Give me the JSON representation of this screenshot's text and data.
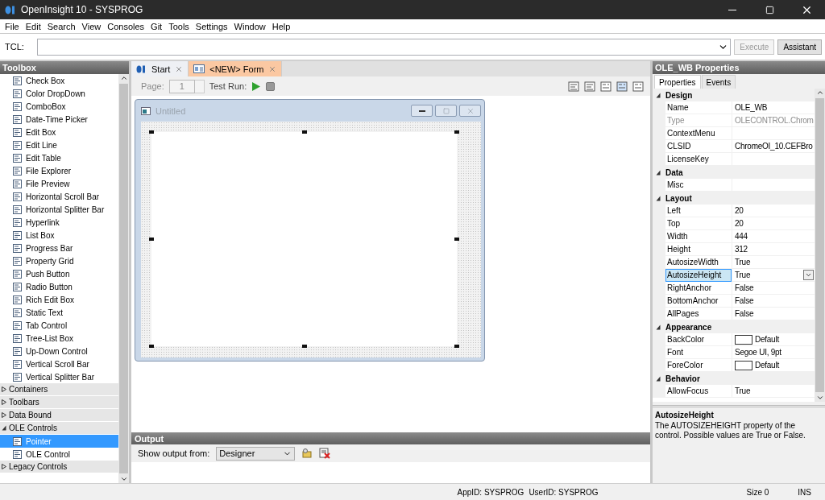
{
  "window": {
    "title": "OpenInsight 10 - SYSPROG"
  },
  "menu": [
    "File",
    "Edit",
    "Search",
    "View",
    "Consoles",
    "Git",
    "Tools",
    "Settings",
    "Window",
    "Help"
  ],
  "tcl": {
    "label": "TCL:"
  },
  "tcl_buttons": [
    {
      "label": "Execute",
      "disabled": true
    },
    {
      "label": "Assistant",
      "disabled": false
    }
  ],
  "toolbox": {
    "title": "Toolbox",
    "items": [
      {
        "label": "Check Box",
        "selected": false
      },
      {
        "label": "Color DropDown",
        "selected": false
      },
      {
        "label": "ComboBox",
        "selected": false
      },
      {
        "label": "Date-Time Picker",
        "selected": false
      },
      {
        "label": "Edit Box",
        "selected": false
      },
      {
        "label": "Edit Line",
        "selected": false
      },
      {
        "label": "Edit Table",
        "selected": false
      },
      {
        "label": "File Explorer",
        "selected": false
      },
      {
        "label": "File Preview",
        "selected": false
      },
      {
        "label": "Horizontal Scroll Bar",
        "selected": false
      },
      {
        "label": "Horizontal Splitter Bar",
        "selected": false
      },
      {
        "label": "Hyperlink",
        "selected": false
      },
      {
        "label": "List Box",
        "selected": false
      },
      {
        "label": "Progress Bar",
        "selected": false
      },
      {
        "label": "Property Grid",
        "selected": false
      },
      {
        "label": "Push Button",
        "selected": false
      },
      {
        "label": "Radio Button",
        "selected": false
      },
      {
        "label": "Rich Edit Box",
        "selected": false
      },
      {
        "label": "Static Text",
        "selected": false
      },
      {
        "label": "Tab Control",
        "selected": false
      },
      {
        "label": "Tree-List Box",
        "selected": false
      },
      {
        "label": "Up-Down Control",
        "selected": false
      },
      {
        "label": "Vertical Scroll Bar",
        "selected": false
      },
      {
        "label": "Vertical Splitter Bar",
        "selected": false
      }
    ],
    "groups": [
      {
        "label": "Containers",
        "expanded": false
      },
      {
        "label": "Toolbars",
        "expanded": false
      },
      {
        "label": "Data Bound",
        "expanded": false
      },
      {
        "label": "OLE Controls",
        "expanded": true,
        "children": [
          {
            "label": "Pointer",
            "selected": true
          },
          {
            "label": "OLE Control",
            "selected": false
          }
        ]
      },
      {
        "label": "Legacy Controls",
        "expanded": false
      }
    ]
  },
  "documents": {
    "tabs": [
      {
        "label": "Start",
        "kind": "start",
        "selected": false
      },
      {
        "label": "<NEW> Form",
        "kind": "designer",
        "selected": true
      }
    ],
    "toolbar": {
      "page_label": "Page:",
      "page_value": "1",
      "page_disabled": true,
      "test_run_label": "Test Run:"
    },
    "form": {
      "title": "Untitled"
    }
  },
  "output": {
    "title": "Output",
    "filter_label": "Show output from:",
    "filter_value": "Designer"
  },
  "properties": {
    "title": "OLE_WB Properties",
    "tabs": [
      {
        "label": "Properties",
        "selected": true
      },
      {
        "label": "Events",
        "selected": false
      }
    ],
    "categories": [
      {
        "label": "Design",
        "expanded": true,
        "rows": [
          {
            "name": "Name",
            "value": "OLE_WB",
            "kind": "text",
            "selected": false,
            "disabled": false
          },
          {
            "name": "Type",
            "value": "OLECONTROL.Chrom",
            "kind": "text",
            "selected": false,
            "disabled": true
          },
          {
            "name": "ContextMenu",
            "kind": "text",
            "selected": false,
            "disabled": false
          },
          {
            "name": "CLSID",
            "value": "ChromeOI_10.CEFBro",
            "kind": "text",
            "selected": false,
            "disabled": false
          },
          {
            "name": "LicenseKey",
            "kind": "text",
            "selected": false,
            "disabled": false
          }
        ]
      },
      {
        "label": "Data",
        "expanded": true,
        "rows": [
          {
            "name": "Misc",
            "kind": "text",
            "selected": false,
            "disabled": false
          }
        ]
      },
      {
        "label": "Layout",
        "expanded": true,
        "rows": [
          {
            "name": "Left",
            "value": "20",
            "kind": "text",
            "selected": false,
            "disabled": false
          },
          {
            "name": "Top",
            "value": "20",
            "kind": "text",
            "selected": false,
            "disabled": false
          },
          {
            "name": "Width",
            "value": "444",
            "kind": "text",
            "selected": false,
            "disabled": false
          },
          {
            "name": "Height",
            "value": "312",
            "kind": "text",
            "selected": false,
            "disabled": false
          },
          {
            "name": "AutosizeWidth",
            "value": "True",
            "kind": "text",
            "selected": false,
            "disabled": false
          },
          {
            "name": "AutosizeHeight",
            "value": "True",
            "kind": "text",
            "selected": true,
            "disabled": false
          },
          {
            "name": "RightAnchor",
            "value": "False",
            "kind": "text",
            "selected": false,
            "disabled": false
          },
          {
            "name": "BottomAnchor",
            "value": "False",
            "kind": "text",
            "selected": false,
            "disabled": false
          },
          {
            "name": "AllPages",
            "value": "False",
            "kind": "text",
            "selected": false,
            "disabled": false
          }
        ]
      },
      {
        "label": "Appearance",
        "expanded": true,
        "rows": [
          {
            "name": "BackColor",
            "value": "Default",
            "kind": "color",
            "selected": false,
            "disabled": false
          },
          {
            "name": "Font",
            "value": "Segoe UI, 9pt",
            "kind": "text",
            "selected": false,
            "disabled": false
          },
          {
            "name": "ForeColor",
            "value": "Default",
            "kind": "color",
            "selected": false,
            "disabled": false
          }
        ]
      },
      {
        "label": "Behavior",
        "expanded": true,
        "rows": [
          {
            "name": "AllowFocus",
            "value": "True",
            "kind": "text",
            "selected": false,
            "disabled": false
          }
        ]
      }
    ],
    "description": {
      "title": "AutosizeHeight",
      "text": "The AUTOSIZEHEIGHT property of the control. Possible values are True or False."
    }
  },
  "status_bar": {
    "app_id": "AppID: SYSPROG",
    "user_id": "UserID: SYSPROG",
    "size": "Size 0",
    "mode": "INS"
  }
}
